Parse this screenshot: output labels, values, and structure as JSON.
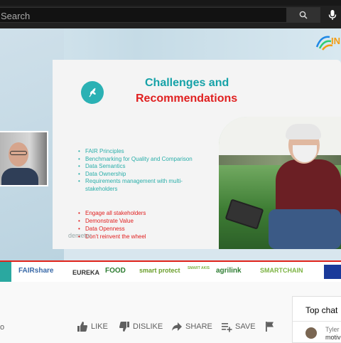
{
  "search": {
    "placeholder": "Search"
  },
  "slide": {
    "title_line1": "Challenges and",
    "title_line2": "Recommendations",
    "challenges": [
      "FAIR Principles",
      "Benchmarking for Quality and Comparison",
      "Data Semantics",
      "Data Ownership",
      "Requirements management with multi-stakeholders"
    ],
    "recommendations": [
      "Engage all stakeholders",
      "Demonstrate Value",
      "Data Openness",
      "Don't reinvent the wheel"
    ],
    "footer_logo": "demeter"
  },
  "brand_logo": "IN",
  "partner_logos": [
    "FAIRshare",
    "EUREKA",
    "FOOD",
    "smart protect",
    "SMART AKIS",
    "agrilink",
    "SMARTCHAIN"
  ],
  "actions": {
    "views": "o",
    "like": "LIKE",
    "dislike": "DISLIKE",
    "share": "SHARE",
    "save": "SAVE"
  },
  "chat": {
    "header": "Top chat",
    "user": "Tyler",
    "message": "motiv"
  },
  "colors": {
    "teal": "#16a2a8",
    "red": "#e02020",
    "topbar": "#212121"
  }
}
